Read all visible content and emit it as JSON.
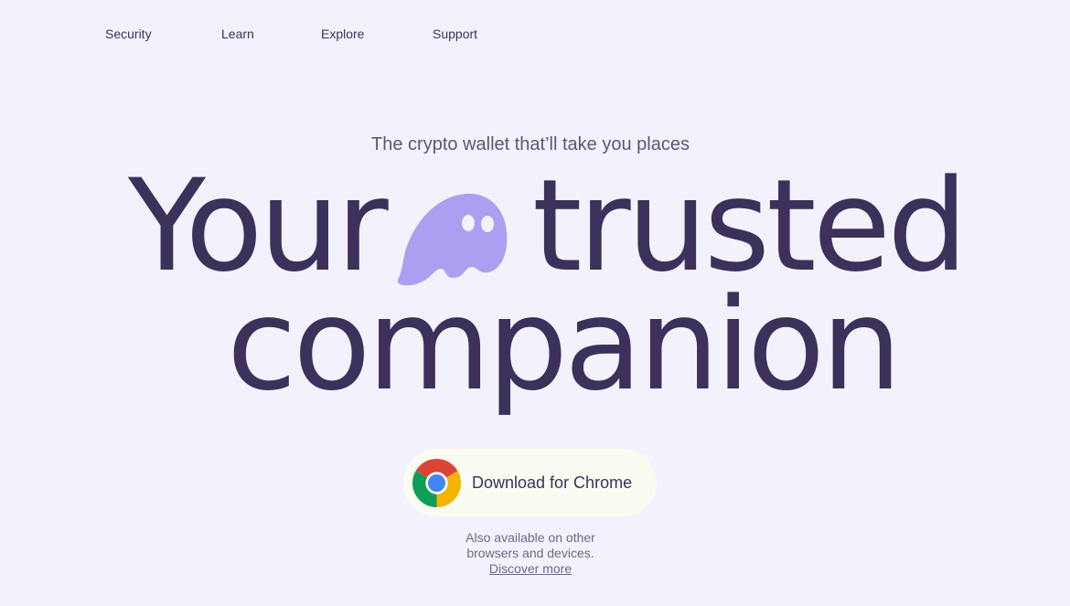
{
  "nav": {
    "items": [
      {
        "label": "Security"
      },
      {
        "label": "Learn"
      },
      {
        "label": "Explore"
      },
      {
        "label": "Support"
      }
    ]
  },
  "hero": {
    "tagline": "The crypto wallet that’ll take you places",
    "headline_word_1": "Your",
    "headline_word_2": "trusted",
    "headline_word_3": "companion",
    "mascot_icon": "ghost-icon"
  },
  "cta": {
    "label": "Download for Chrome",
    "icon": "chrome-icon"
  },
  "availability": {
    "line1": "Also available on other",
    "line2": "browsers and devices.",
    "link": "Discover more"
  },
  "colors": {
    "background": "#f3f2fc",
    "text": "#3c315b",
    "accent": "#ab9ff2",
    "button_bg": "#fbfbf2"
  }
}
